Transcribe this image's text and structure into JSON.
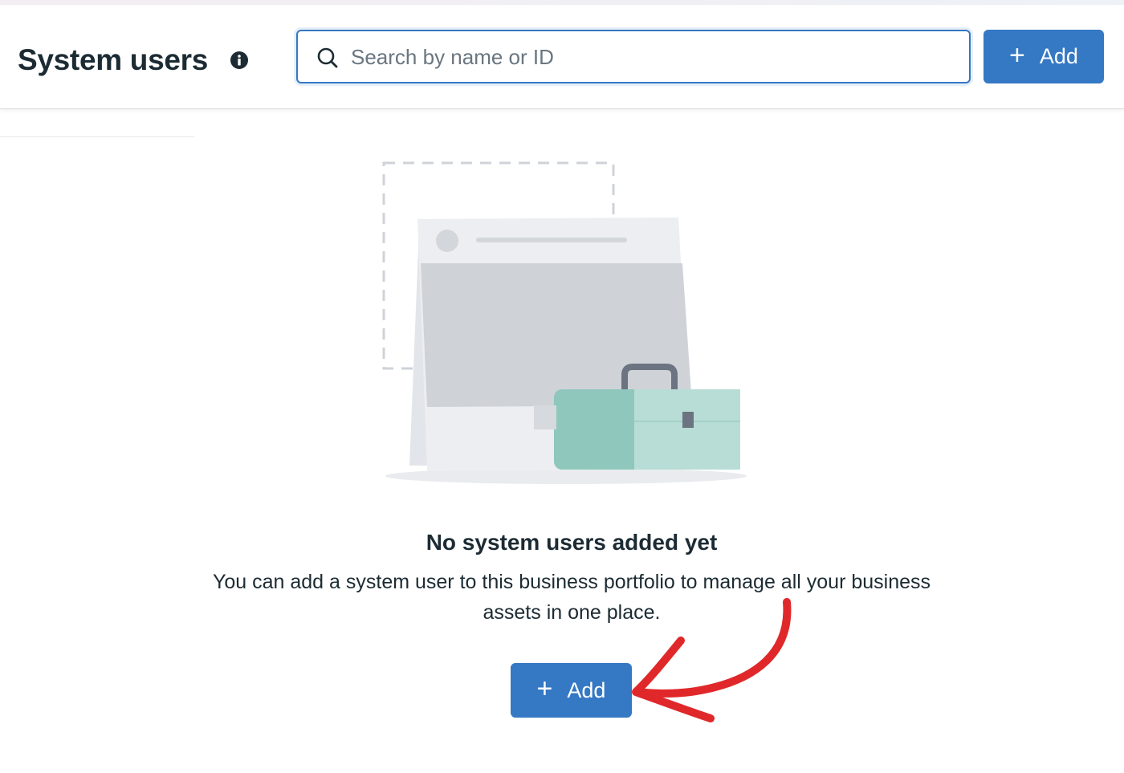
{
  "header": {
    "title": "System users",
    "info_icon": "info-icon",
    "search": {
      "placeholder": "Search by name or ID",
      "value": "",
      "icon": "search-icon"
    },
    "add_button": {
      "label": "Add",
      "icon": "plus-icon"
    }
  },
  "empty_state": {
    "illustration": "toolbox-illustration",
    "title": "No system users added yet",
    "description": "You can add a system user to this business portfolio to manage all your business assets in one place.",
    "add_button": {
      "label": "Add",
      "icon": "plus-icon"
    }
  },
  "annotation": {
    "icon": "red-arrow-icon"
  },
  "colors": {
    "primary": "#3578c4",
    "text": "#1c2b33",
    "placeholder": "#6a7680",
    "accent_teal": "#8fc7bd",
    "arrow_red": "#e0282a"
  }
}
